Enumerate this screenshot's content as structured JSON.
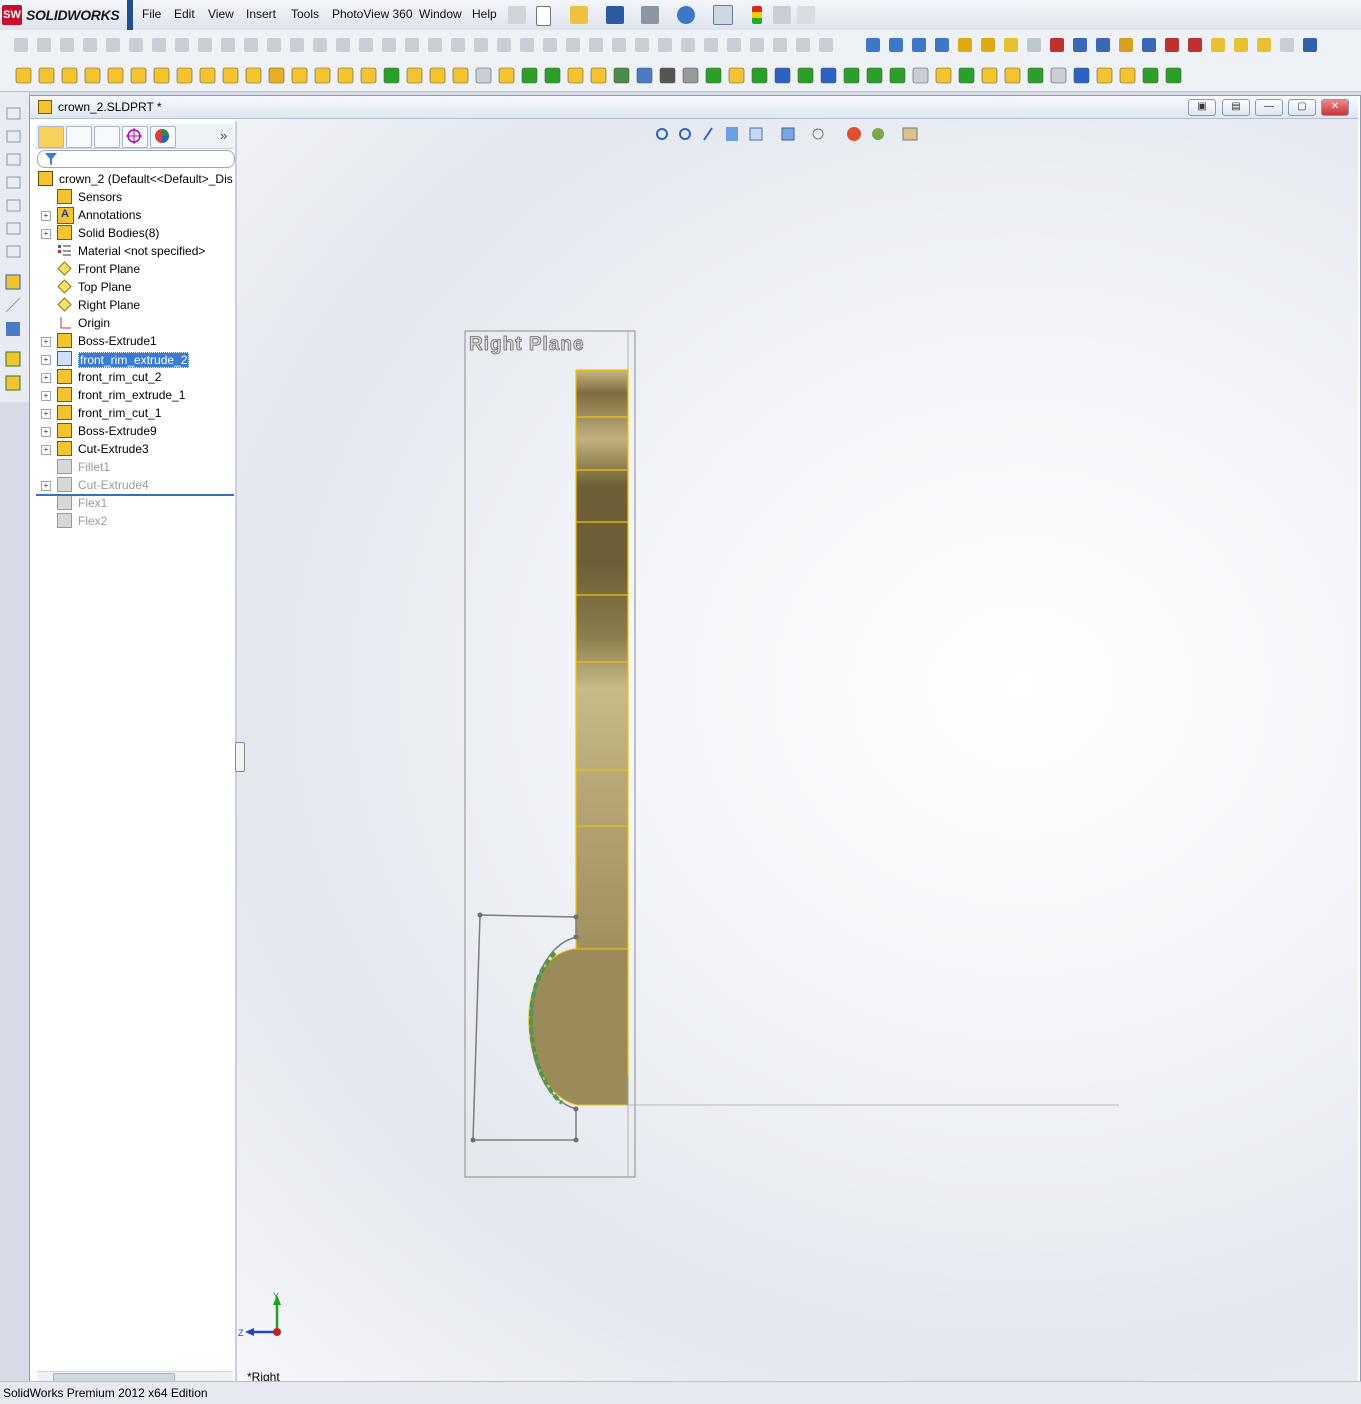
{
  "app": {
    "brand": "SOLIDWORKS",
    "brand_mark": "SW"
  },
  "menu": [
    "File",
    "Edit",
    "View",
    "Insert",
    "Tools",
    "PhotoView 360",
    "Window",
    "Help"
  ],
  "document": {
    "title": "crown_2.SLDPRT *"
  },
  "window_buttons": {
    "restore1": "▣",
    "restore2": "▤",
    "minimize": "—",
    "maximize": "▢",
    "close": "✕"
  },
  "feature_tree": {
    "root": "crown_2  (Default<<Default>_Dis",
    "items": [
      {
        "label": "Sensors",
        "icon": "sensors-icon",
        "expandable": false,
        "dim": false,
        "selected": false
      },
      {
        "label": "Annotations",
        "icon": "annotations-icon",
        "expandable": true,
        "dim": false,
        "selected": false
      },
      {
        "label": "Solid Bodies(8)",
        "icon": "solid-bodies-icon",
        "expandable": true,
        "dim": false,
        "selected": false
      },
      {
        "label": "Material <not specified>",
        "icon": "material-icon",
        "expandable": false,
        "dim": false,
        "selected": false
      },
      {
        "label": "Front Plane",
        "icon": "plane-icon",
        "expandable": false,
        "dim": false,
        "selected": false
      },
      {
        "label": "Top Plane",
        "icon": "plane-icon",
        "expandable": false,
        "dim": false,
        "selected": false
      },
      {
        "label": "Right Plane",
        "icon": "plane-icon",
        "expandable": false,
        "dim": false,
        "selected": false
      },
      {
        "label": "Origin",
        "icon": "origin-icon",
        "expandable": false,
        "dim": false,
        "selected": false
      },
      {
        "label": "Boss-Extrude1",
        "icon": "extrude-icon",
        "expandable": true,
        "dim": false,
        "selected": false
      },
      {
        "label": "front_rim_extrude_2",
        "icon": "extrude-icon",
        "expandable": true,
        "dim": false,
        "selected": true
      },
      {
        "label": "front_rim_cut_2",
        "icon": "cut-icon",
        "expandable": true,
        "dim": false,
        "selected": false
      },
      {
        "label": "front_rim_extrude_1",
        "icon": "extrude-icon",
        "expandable": true,
        "dim": false,
        "selected": false
      },
      {
        "label": "front_rim_cut_1",
        "icon": "cut-icon",
        "expandable": true,
        "dim": false,
        "selected": false
      },
      {
        "label": "Boss-Extrude9",
        "icon": "extrude-icon",
        "expandable": true,
        "dim": false,
        "selected": false
      },
      {
        "label": "Cut-Extrude3",
        "icon": "cut-icon",
        "expandable": true,
        "dim": false,
        "selected": false
      },
      {
        "label": "Fillet1",
        "icon": "fillet-icon",
        "expandable": false,
        "dim": true,
        "selected": false
      },
      {
        "label": "Cut-Extrude4",
        "icon": "cut-icon",
        "expandable": true,
        "dim": true,
        "selected": false
      },
      {
        "label": "Flex1",
        "icon": "flex-icon",
        "expandable": false,
        "dim": true,
        "selected": false
      },
      {
        "label": "Flex2",
        "icon": "flex-icon",
        "expandable": false,
        "dim": true,
        "selected": false
      }
    ]
  },
  "viewport": {
    "plane_label": "Right Plane",
    "triad": {
      "y": "Y",
      "z": "Z"
    },
    "view_name": "*Right"
  },
  "status": {
    "text": "SolidWorks Premium 2012 x64 Edition"
  },
  "colors": {
    "selection": "#3a7bd5",
    "feature_yellow": "#f4c430",
    "part_body": "#a89866",
    "part_edge": "#f2c200",
    "brand_red": "#c8102e"
  }
}
